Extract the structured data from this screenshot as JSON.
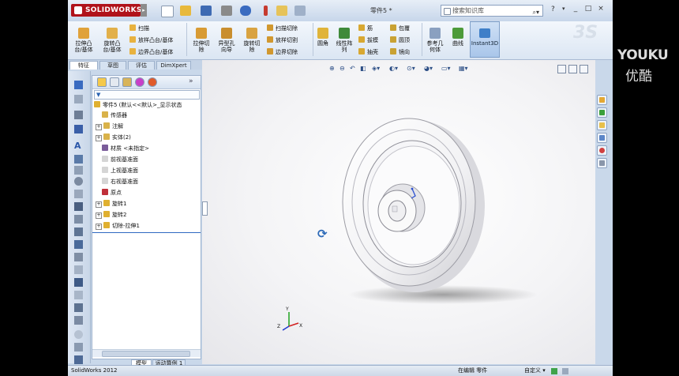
{
  "app": {
    "brand": "SOLIDWORKS",
    "document_title": "零件5 *",
    "search_placeholder": "搜索知识库",
    "help_label": "?",
    "minimize": "_",
    "restore": "□",
    "close": "×"
  },
  "ribbon": {
    "group1": [
      {
        "label": "拉伸凸\n台/基体"
      },
      {
        "label": "旋转凸\n台/基体"
      }
    ],
    "group1_small": [
      "扫描",
      "放样凸台/基体",
      "边界凸台/基体"
    ],
    "group2": [
      {
        "label": "拉伸切\n除"
      },
      {
        "label": "异型孔\n向导"
      },
      {
        "label": "旋转切\n除"
      }
    ],
    "group2_small": [
      "扫描切除",
      "放样切割",
      "边界切除"
    ],
    "group3": [
      {
        "label": "圆角"
      },
      {
        "label": "线性阵\n列"
      }
    ],
    "group3_small": [
      "筋",
      "拔模",
      "抽壳"
    ],
    "group3_small2": [
      "包覆",
      "圆顶",
      "镜向"
    ],
    "group4": [
      {
        "label": "参考几\n何体"
      },
      {
        "label": "曲线"
      }
    ],
    "instant3d": "Instant3D"
  },
  "tabs": [
    "特征",
    "草图",
    "评估",
    "DimXpert"
  ],
  "feature_tree": {
    "root": "零件5 (默认<<默认>_显示状态",
    "items": [
      {
        "label": "传感器",
        "expander": "",
        "color": "#d9b24a"
      },
      {
        "label": "注解",
        "expander": "+",
        "color": "#d9b24a"
      },
      {
        "label": "实体(2)",
        "expander": "+",
        "color": "#d9b24a"
      },
      {
        "label": "材质 <未指定>",
        "expander": "",
        "color": "#7a5c9a"
      },
      {
        "label": "前视基准面",
        "expander": "",
        "color": "#d5d5d5"
      },
      {
        "label": "上视基准面",
        "expander": "",
        "color": "#d5d5d5"
      },
      {
        "label": "右视基准面",
        "expander": "",
        "color": "#d5d5d5"
      },
      {
        "label": "原点",
        "expander": "",
        "color": "#c0303a"
      },
      {
        "label": "旋转1",
        "expander": "+",
        "color": "#e0b030"
      },
      {
        "label": "旋转2",
        "expander": "+",
        "color": "#e0b030"
      },
      {
        "label": "切除-拉伸1",
        "expander": "+",
        "color": "#e0b030"
      }
    ]
  },
  "bottom_tabs": [
    "模型",
    "运动算例 1"
  ],
  "status": {
    "left": "SolidWorks 2012",
    "editing": "在编辑 零件",
    "custom": "自定义 ▾"
  },
  "watermark": {
    "line1": "YOUKU",
    "line2": "优酷"
  }
}
